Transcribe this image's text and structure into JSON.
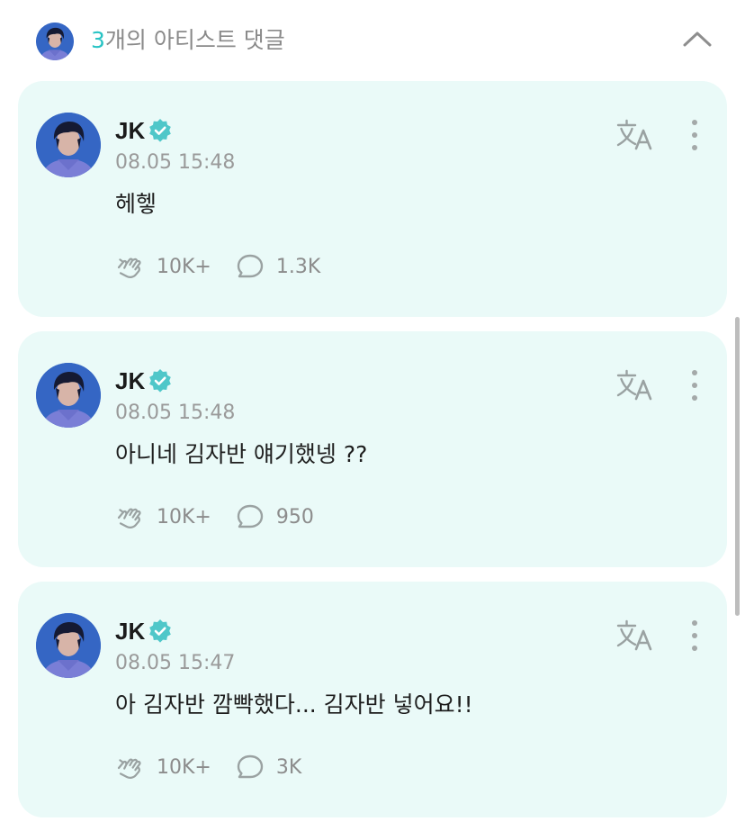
{
  "header": {
    "count": "3",
    "title_suffix": "개의 아티스트 댓글",
    "collapse_icon": "chevron-up-icon"
  },
  "comments": [
    {
      "author": "JK",
      "verified": true,
      "timestamp": "08.05 15:48",
      "text": "헤헿",
      "likes": "10K+",
      "replies": "1.3K"
    },
    {
      "author": "JK",
      "verified": true,
      "timestamp": "08.05 15:48",
      "text": "아니네 김자반 얘기했넹 ??",
      "likes": "10K+",
      "replies": "950"
    },
    {
      "author": "JK",
      "verified": true,
      "timestamp": "08.05 15:47",
      "text": "아 김자반 깜빡했다... 김자반 넣어요!!",
      "likes": "10K+",
      "replies": "3K"
    }
  ],
  "icons": {
    "like": "cheer-hand-icon",
    "reply": "speech-bubble-icon",
    "translate": "translate-icon",
    "more": "more-vertical-icon",
    "verified": "verified-badge-icon"
  },
  "colors": {
    "accent": "#27c3c4",
    "card_bg": "#eafaf8",
    "verified": "#4fc7c9"
  }
}
